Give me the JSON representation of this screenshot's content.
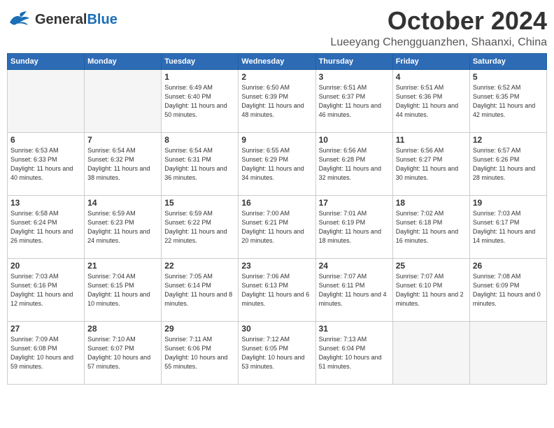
{
  "header": {
    "logo_general": "General",
    "logo_blue": "Blue",
    "month": "October 2024",
    "location": "Lueeyang Chengguanzhen, Shaanxi, China"
  },
  "weekdays": [
    "Sunday",
    "Monday",
    "Tuesday",
    "Wednesday",
    "Thursday",
    "Friday",
    "Saturday"
  ],
  "weeks": [
    [
      {
        "day": "",
        "empty": true
      },
      {
        "day": "",
        "empty": true
      },
      {
        "day": "1",
        "sunrise": "6:49 AM",
        "sunset": "6:40 PM",
        "daylight": "11 hours and 50 minutes."
      },
      {
        "day": "2",
        "sunrise": "6:50 AM",
        "sunset": "6:39 PM",
        "daylight": "11 hours and 48 minutes."
      },
      {
        "day": "3",
        "sunrise": "6:51 AM",
        "sunset": "6:37 PM",
        "daylight": "11 hours and 46 minutes."
      },
      {
        "day": "4",
        "sunrise": "6:51 AM",
        "sunset": "6:36 PM",
        "daylight": "11 hours and 44 minutes."
      },
      {
        "day": "5",
        "sunrise": "6:52 AM",
        "sunset": "6:35 PM",
        "daylight": "11 hours and 42 minutes."
      }
    ],
    [
      {
        "day": "6",
        "sunrise": "6:53 AM",
        "sunset": "6:33 PM",
        "daylight": "11 hours and 40 minutes."
      },
      {
        "day": "7",
        "sunrise": "6:54 AM",
        "sunset": "6:32 PM",
        "daylight": "11 hours and 38 minutes."
      },
      {
        "day": "8",
        "sunrise": "6:54 AM",
        "sunset": "6:31 PM",
        "daylight": "11 hours and 36 minutes."
      },
      {
        "day": "9",
        "sunrise": "6:55 AM",
        "sunset": "6:29 PM",
        "daylight": "11 hours and 34 minutes."
      },
      {
        "day": "10",
        "sunrise": "6:56 AM",
        "sunset": "6:28 PM",
        "daylight": "11 hours and 32 minutes."
      },
      {
        "day": "11",
        "sunrise": "6:56 AM",
        "sunset": "6:27 PM",
        "daylight": "11 hours and 30 minutes."
      },
      {
        "day": "12",
        "sunrise": "6:57 AM",
        "sunset": "6:26 PM",
        "daylight": "11 hours and 28 minutes."
      }
    ],
    [
      {
        "day": "13",
        "sunrise": "6:58 AM",
        "sunset": "6:24 PM",
        "daylight": "11 hours and 26 minutes."
      },
      {
        "day": "14",
        "sunrise": "6:59 AM",
        "sunset": "6:23 PM",
        "daylight": "11 hours and 24 minutes."
      },
      {
        "day": "15",
        "sunrise": "6:59 AM",
        "sunset": "6:22 PM",
        "daylight": "11 hours and 22 minutes."
      },
      {
        "day": "16",
        "sunrise": "7:00 AM",
        "sunset": "6:21 PM",
        "daylight": "11 hours and 20 minutes."
      },
      {
        "day": "17",
        "sunrise": "7:01 AM",
        "sunset": "6:19 PM",
        "daylight": "11 hours and 18 minutes."
      },
      {
        "day": "18",
        "sunrise": "7:02 AM",
        "sunset": "6:18 PM",
        "daylight": "11 hours and 16 minutes."
      },
      {
        "day": "19",
        "sunrise": "7:03 AM",
        "sunset": "6:17 PM",
        "daylight": "11 hours and 14 minutes."
      }
    ],
    [
      {
        "day": "20",
        "sunrise": "7:03 AM",
        "sunset": "6:16 PM",
        "daylight": "11 hours and 12 minutes."
      },
      {
        "day": "21",
        "sunrise": "7:04 AM",
        "sunset": "6:15 PM",
        "daylight": "11 hours and 10 minutes."
      },
      {
        "day": "22",
        "sunrise": "7:05 AM",
        "sunset": "6:14 PM",
        "daylight": "11 hours and 8 minutes."
      },
      {
        "day": "23",
        "sunrise": "7:06 AM",
        "sunset": "6:13 PM",
        "daylight": "11 hours and 6 minutes."
      },
      {
        "day": "24",
        "sunrise": "7:07 AM",
        "sunset": "6:11 PM",
        "daylight": "11 hours and 4 minutes."
      },
      {
        "day": "25",
        "sunrise": "7:07 AM",
        "sunset": "6:10 PM",
        "daylight": "11 hours and 2 minutes."
      },
      {
        "day": "26",
        "sunrise": "7:08 AM",
        "sunset": "6:09 PM",
        "daylight": "11 hours and 0 minutes."
      }
    ],
    [
      {
        "day": "27",
        "sunrise": "7:09 AM",
        "sunset": "6:08 PM",
        "daylight": "10 hours and 59 minutes."
      },
      {
        "day": "28",
        "sunrise": "7:10 AM",
        "sunset": "6:07 PM",
        "daylight": "10 hours and 57 minutes."
      },
      {
        "day": "29",
        "sunrise": "7:11 AM",
        "sunset": "6:06 PM",
        "daylight": "10 hours and 55 minutes."
      },
      {
        "day": "30",
        "sunrise": "7:12 AM",
        "sunset": "6:05 PM",
        "daylight": "10 hours and 53 minutes."
      },
      {
        "day": "31",
        "sunrise": "7:13 AM",
        "sunset": "6:04 PM",
        "daylight": "10 hours and 51 minutes."
      },
      {
        "day": "",
        "empty": true
      },
      {
        "day": "",
        "empty": true
      }
    ]
  ]
}
